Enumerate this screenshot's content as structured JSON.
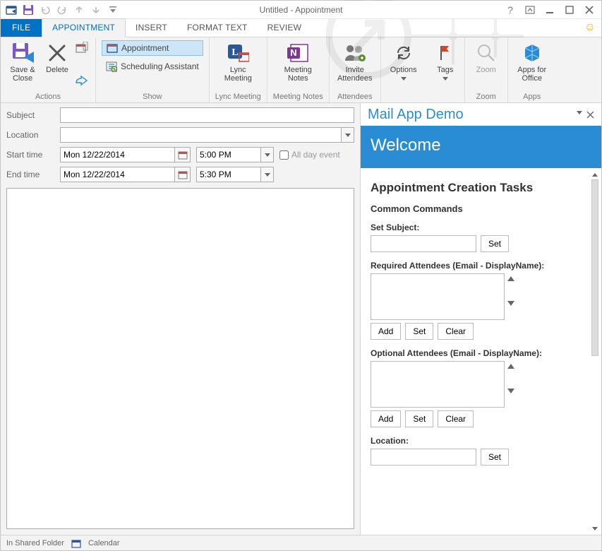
{
  "window": {
    "title": "Untitled - Appointment",
    "help_tooltip": "?"
  },
  "tabs": {
    "file": "FILE",
    "appointment": "APPOINTMENT",
    "insert": "INSERT",
    "format_text": "FORMAT TEXT",
    "review": "REVIEW"
  },
  "ribbon": {
    "actions": {
      "group": "Actions",
      "save_close": "Save &\nClose",
      "delete": "Delete"
    },
    "show": {
      "group": "Show",
      "appointment": "Appointment",
      "scheduling": "Scheduling Assistant"
    },
    "lync": {
      "group": "Lync Meeting",
      "btn": "Lync\nMeeting"
    },
    "onenote": {
      "group": "Meeting Notes",
      "btn": "Meeting\nNotes"
    },
    "attendees": {
      "group": "Attendees",
      "btn": "Invite\nAttendees"
    },
    "options": {
      "group": "Options",
      "btn": "Options"
    },
    "tags": {
      "group": "Tags",
      "btn": "Tags"
    },
    "zoom": {
      "group": "Zoom",
      "btn": "Zoom"
    },
    "apps": {
      "group": "Apps",
      "btn": "Apps for\nOffice"
    }
  },
  "form": {
    "subject_label": "Subject",
    "subject_value": "",
    "location_label": "Location",
    "location_value": "",
    "start_label": "Start time",
    "start_date": "Mon 12/22/2014",
    "start_time": "5:00 PM",
    "end_label": "End time",
    "end_date": "Mon 12/22/2014",
    "end_time": "5:30 PM",
    "all_day": "All day event"
  },
  "status": {
    "shared": "In Shared Folder",
    "calendar": "Calendar"
  },
  "pane": {
    "title": "Mail App Demo",
    "welcome": "Welcome",
    "heading": "Appointment Creation Tasks",
    "common": "Common Commands",
    "set_subject": "Set Subject:",
    "set_btn": "Set",
    "req_attendees": "Required Attendees (Email - DisplayName):",
    "opt_attendees": "Optional Attendees (Email - DisplayName):",
    "add_btn": "Add",
    "clear_btn": "Clear",
    "location": "Location:"
  }
}
